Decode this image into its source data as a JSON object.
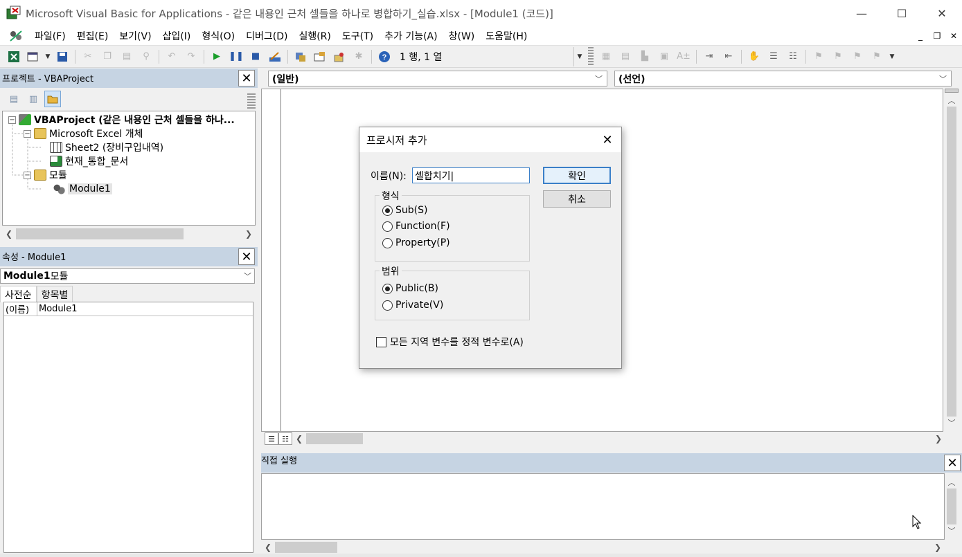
{
  "window": {
    "title": "Microsoft Visual Basic for Applications - 같은 내용인 근처 셀들을 하나로 병합하기_실습.xlsx - [Module1 (코드)]",
    "minimize": "—",
    "maximize": "☐",
    "close": "✕"
  },
  "menu": {
    "items": [
      "파일(F)",
      "편집(E)",
      "보기(V)",
      "삽입(I)",
      "형식(O)",
      "디버그(D)",
      "실행(R)",
      "도구(T)",
      "추가 기능(A)",
      "창(W)",
      "도움말(H)"
    ],
    "mdi_min": "_",
    "mdi_restore": "❐",
    "mdi_close": "✕"
  },
  "toolbar": {
    "position_text": "1 행, 1 열"
  },
  "project_pane": {
    "title": "프로젝트 - VBAProject",
    "close": "✕",
    "root": "VBAProject (같은 내용인 근처 셀들을 하나...",
    "folder_excel": "Microsoft Excel 개체",
    "sheet": "Sheet2 (장비구입내역)",
    "workbook": "현재_통합_문서",
    "folder_modules": "모듈",
    "module": "Module1"
  },
  "properties_pane": {
    "title": "속성 - Module1",
    "close": "✕",
    "combo_bold": "Module1",
    "combo_rest": " 모듈",
    "tab_alpha": "사전순",
    "tab_category": "항목별",
    "rows": [
      {
        "key": "(이름)",
        "value": "Module1"
      }
    ]
  },
  "code_window": {
    "object_combo": "(일반)",
    "proc_combo": "(선언)"
  },
  "immediate": {
    "title": "직접 실행",
    "close": "✕"
  },
  "dialog": {
    "title": "프로시저 추가",
    "close": "✕",
    "name_label": "이름(N):",
    "name_value": "셀합치기|",
    "ok": "확인",
    "cancel": "취소",
    "type_group": "형식",
    "type_options": [
      "Sub(S)",
      "Function(F)",
      "Property(P)"
    ],
    "type_selected": 0,
    "scope_group": "범위",
    "scope_options": [
      "Public(B)",
      "Private(V)"
    ],
    "scope_selected": 0,
    "static_checkbox": "모든 지역 변수를 정적 변수로(A)",
    "static_checked": false
  }
}
